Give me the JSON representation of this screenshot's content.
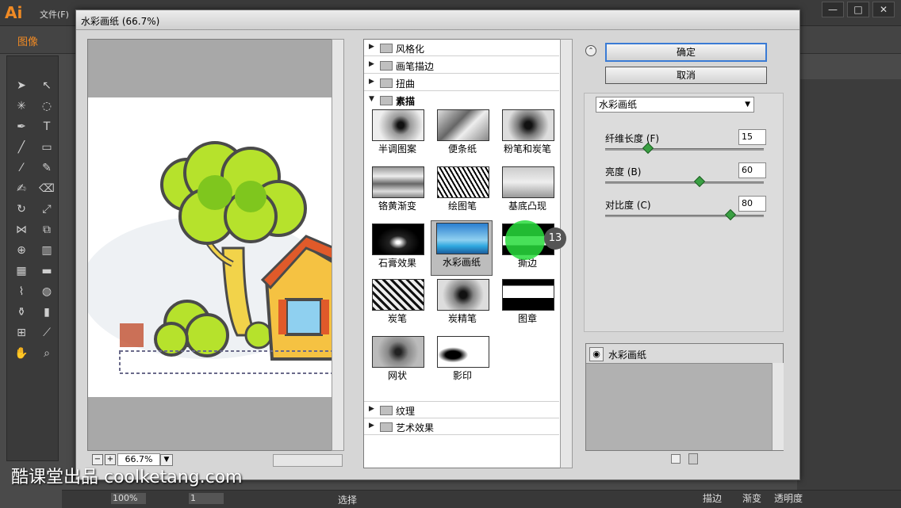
{
  "app": {
    "logo": "Ai",
    "menu_file": "文件(F)",
    "control_label": "图像",
    "window_buttons": [
      "—",
      "□",
      "✕"
    ]
  },
  "dialog": {
    "title": "水彩画纸 (66.7%)",
    "zoom": "66.7%"
  },
  "filters": {
    "categories_top": [
      {
        "label": "风格化",
        "expanded": false
      },
      {
        "label": "画笔描边",
        "expanded": false
      },
      {
        "label": "扭曲",
        "expanded": false
      },
      {
        "label": "素描",
        "expanded": true
      }
    ],
    "thumbnails": [
      {
        "label": "半调图案"
      },
      {
        "label": "便条纸"
      },
      {
        "label": "粉笔和炭笔"
      },
      {
        "label": "铬黄渐变"
      },
      {
        "label": "绘图笔"
      },
      {
        "label": "基底凸现"
      },
      {
        "label": "石膏效果"
      },
      {
        "label": "水彩画纸",
        "selected": true
      },
      {
        "label": "撕边"
      },
      {
        "label": "炭笔"
      },
      {
        "label": "炭精笔"
      },
      {
        "label": "图章"
      },
      {
        "label": "网状"
      },
      {
        "label": "影印"
      }
    ],
    "categories_bottom": [
      {
        "label": "纹理",
        "expanded": false
      },
      {
        "label": "艺术效果",
        "expanded": false
      }
    ]
  },
  "buttons": {
    "ok": "确定",
    "cancel": "取消"
  },
  "settings": {
    "selected_filter": "水彩画纸",
    "params": [
      {
        "label": "纤维长度 (F)",
        "value": "15",
        "level": 0.27
      },
      {
        "label": "亮度 (B)",
        "value": "60",
        "level": 0.6
      },
      {
        "label": "对比度 (C)",
        "value": "80",
        "level": 0.8
      }
    ]
  },
  "effect_layers": [
    {
      "label": "水彩画纸"
    }
  ],
  "status": {
    "zoom": "100%",
    "page": "1",
    "tool": "选择",
    "tabs": [
      "描边",
      "渐变",
      "透明度"
    ]
  },
  "overlay": {
    "step": "13",
    "watermark": "酷课堂出品 coolketang.com"
  },
  "colors": {
    "accent": "#f08a24",
    "ok_border": "#3a7bd5",
    "knob": "#3aa043"
  }
}
